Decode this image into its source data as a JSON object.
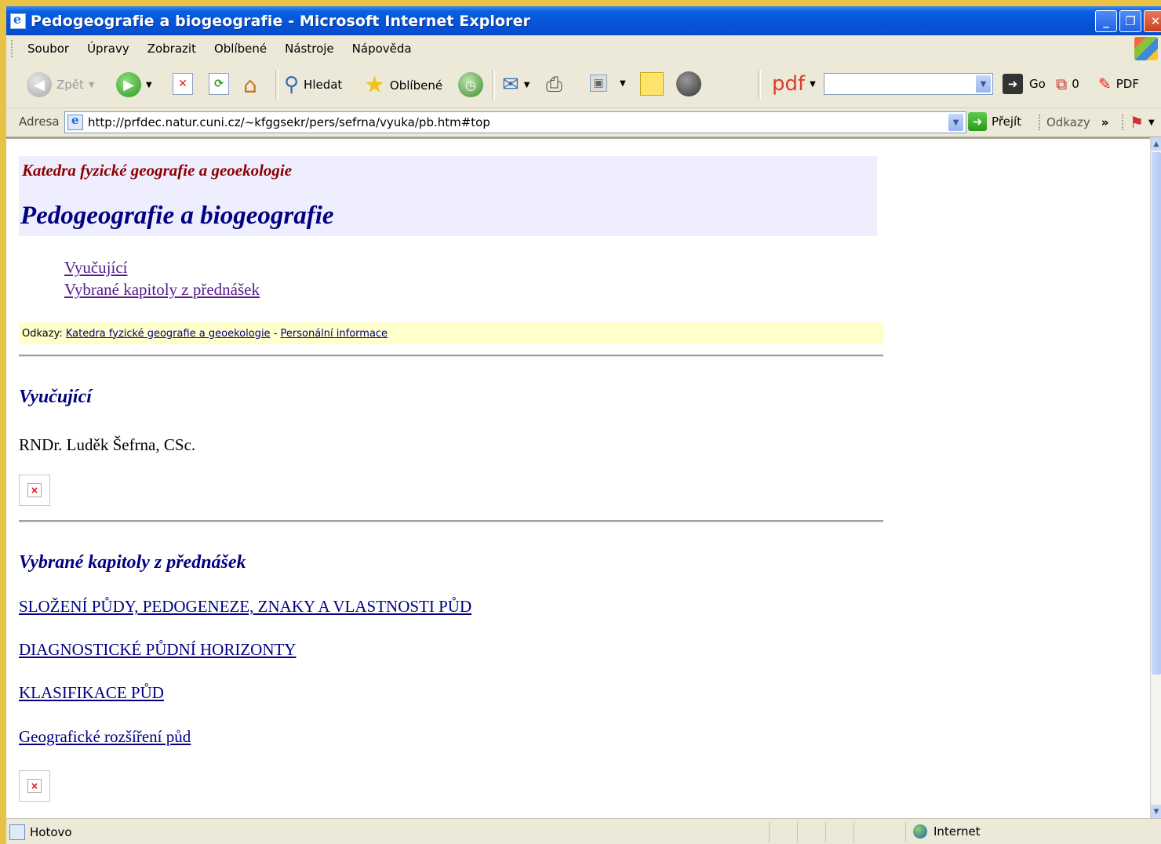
{
  "window": {
    "title": "Pedogeografie a biogeografie - Microsoft Internet Explorer",
    "buttons": {
      "minimize": "_",
      "restore": "❐",
      "close": "✕"
    }
  },
  "menu": [
    "Soubor",
    "Úpravy",
    "Zobrazit",
    "Oblíbené",
    "Nástroje",
    "Nápověda"
  ],
  "toolbar": {
    "back": "Zpět",
    "search": "Hledat",
    "favorites": "Oblíbené",
    "pdf": "pdf",
    "pdf_search_value": "",
    "go": "Go",
    "counter": "0",
    "pdf_button": "PDF"
  },
  "address": {
    "label": "Adresa",
    "url": "http://prfdec.natur.cuni.cz/~kfggsekr/pers/sefrna/vyuka/pb.htm#top",
    "go": "Přejít",
    "links": "Odkazy",
    "more": "»"
  },
  "page": {
    "dept": "Katedra fyzické geografie a geoekologie",
    "title": "Pedogeografie a biogeografie",
    "toc": [
      "Vyučující",
      "Vybrané kapitoly z přednášek"
    ],
    "links_label": "Odkazy:",
    "links": [
      "Katedra fyzické geografie a geoekologie",
      "Personální informace"
    ],
    "links_sep": " - ",
    "section1": {
      "heading": "Vyučující",
      "text": "RNDr. Luděk Šefrna, CSc."
    },
    "section2": {
      "heading": "Vybrané kapitoly z přednášek",
      "chapters": [
        "SLOŽENÍ PŮDY, PEDOGENEZE, ZNAKY A VLASTNOSTI PŮD",
        "DIAGNOSTICKÉ PŮDNÍ HORIZONTY",
        "KLASIFIKACE PŮD",
        "Geografické rozšíření půd"
      ]
    }
  },
  "status": {
    "text": "Hotovo",
    "zone": "Internet"
  },
  "colors": {
    "dept": "#8b0000",
    "title": "#000080",
    "header_band": "#eeeeff",
    "links_band": "#ffffcc",
    "visited": "#551a8b"
  }
}
